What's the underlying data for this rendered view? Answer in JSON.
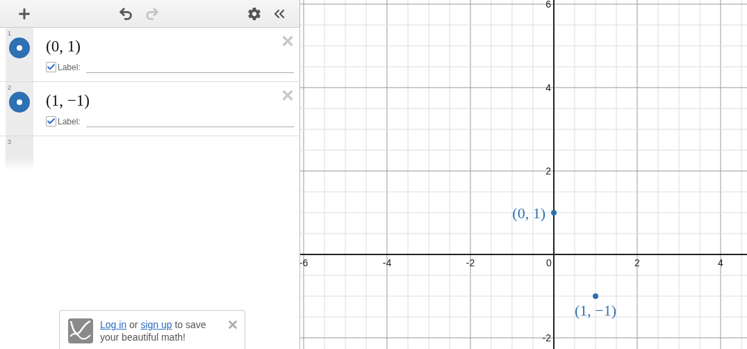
{
  "toolbar": {
    "buttons": [
      {
        "kind": "add",
        "disabled": false
      },
      {
        "kind": "undo",
        "disabled": false
      },
      {
        "kind": "redo",
        "disabled": true
      },
      {
        "kind": "settings",
        "disabled": false
      },
      {
        "kind": "collapse",
        "disabled": false
      }
    ]
  },
  "expressions": [
    {
      "number": "1",
      "latex": "(0, 1)",
      "color": "#2d70b3",
      "label_checked": true,
      "label_caption": "Label:"
    },
    {
      "number": "2",
      "latex": "(1, −1)",
      "color": "#2d70b3",
      "label_checked": true,
      "label_caption": "Label:"
    }
  ],
  "empty_row": {
    "number": "3"
  },
  "save_banner": {
    "parts": [
      {
        "kind": "link",
        "text": "Log in"
      },
      {
        "kind": "text",
        "text": "or"
      },
      {
        "kind": "link",
        "text": "sign up"
      },
      {
        "kind": "text",
        "text": "to save your beautiful math!"
      }
    ]
  },
  "graph": {
    "chart_data": {
      "type": "scatter",
      "x": [
        0,
        1
      ],
      "series": [
        {
          "color": "#2d70b3",
          "values": [
            1,
            -1
          ]
        }
      ],
      "grid": true,
      "xlim": [
        -6.083,
        4.633
      ],
      "ylim": [
        -2.267,
        6.1
      ],
      "xticks": [
        -6,
        -4,
        -2,
        0,
        2,
        4
      ],
      "yticks": [
        -2,
        2,
        4,
        6
      ],
      "value_labels": [
        "(0, 1)",
        "(1, −1)"
      ]
    }
  }
}
